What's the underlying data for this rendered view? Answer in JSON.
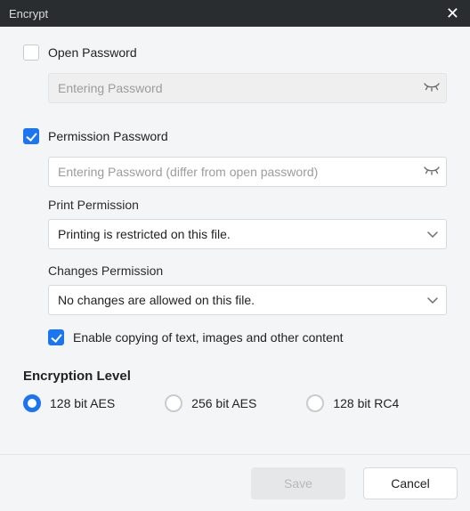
{
  "window": {
    "title": "Encrypt"
  },
  "open_password": {
    "label": "Open Password",
    "checked": false,
    "placeholder": "Entering Password",
    "value": ""
  },
  "permission_password": {
    "label": "Permission Password",
    "checked": true,
    "placeholder": "Entering Password (differ from open password)",
    "value": "",
    "print_label": "Print Permission",
    "print_value": "Printing is restricted on this file.",
    "changes_label": "Changes Permission",
    "changes_value": "No changes are allowed on this file.",
    "enable_copy_label": "Enable copying of text, images and other content",
    "enable_copy_checked": true
  },
  "encryption": {
    "title": "Encryption Level",
    "options": {
      "aes128": "128 bit AES",
      "aes256": "256 bit AES",
      "rc4128": "128 bit RC4"
    },
    "selected": "aes128"
  },
  "footer": {
    "save": "Save",
    "cancel": "Cancel"
  }
}
